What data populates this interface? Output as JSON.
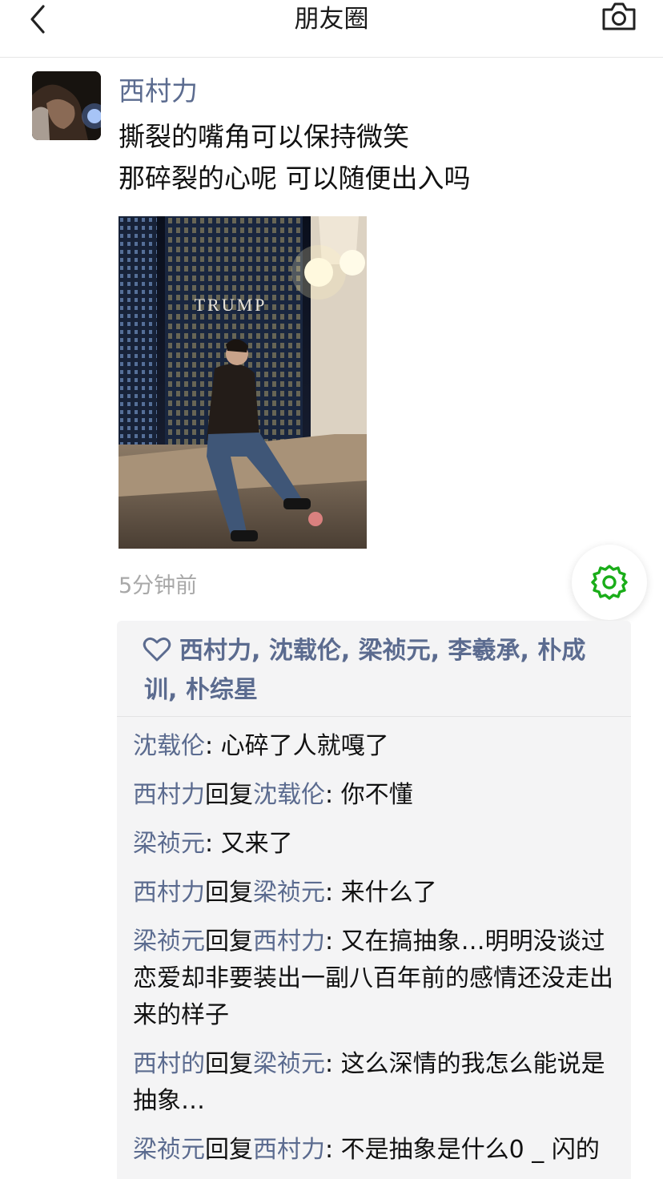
{
  "header": {
    "title": "朋友圈"
  },
  "post": {
    "author": "西村力",
    "text_lines": [
      "撕裂的嘴角可以保持微笑",
      "那碎裂的心呢 可以随便出入吗"
    ],
    "photo_sign": "TRUMP",
    "timestamp": "5分钟前"
  },
  "likes": {
    "line1": "西村力, 沈载伦, 梁祯元, 李羲承, 朴成",
    "line2": "训, 朴综星"
  },
  "comments": [
    {
      "author": "沈载伦",
      "reply_word": "",
      "reply_to": "",
      "sep": ": ",
      "text": "心碎了人就嘎了"
    },
    {
      "author": "西村力",
      "reply_word": "回复",
      "reply_to": "沈载伦",
      "sep": ": ",
      "text": "你不懂"
    },
    {
      "author": "梁祯元",
      "reply_word": "",
      "reply_to": "",
      "sep": ": ",
      "text": "又来了"
    },
    {
      "author": "西村力",
      "reply_word": "回复",
      "reply_to": "梁祯元",
      "sep": ": ",
      "text": "来什么了"
    },
    {
      "author": "梁祯元",
      "reply_word": "回复",
      "reply_to": "西村力",
      "sep": ": ",
      "text": "又在搞抽象…明明没谈过恋爱却非要装出一副八百年前的感情还没走出来的样子"
    },
    {
      "author": "西村的",
      "reply_word": "回复",
      "reply_to": "梁祯元",
      "sep": ": ",
      "text": "这么深情的我怎么能说是抽象…"
    },
    {
      "author": "梁祯元",
      "reply_word": "回复",
      "reply_to": "西村力",
      "sep": ": ",
      "text": "不是抽象是什么0 _ 闪的"
    }
  ],
  "colors": {
    "name_link": "#5b6b8f",
    "accent_green": "#1aad19",
    "timestamp": "#a8a8a8",
    "panel_bg": "#f4f4f5"
  },
  "icons": {
    "back": "chevron-left-icon",
    "camera": "camera-icon",
    "settings": "gear-icon",
    "like": "heart-icon"
  }
}
